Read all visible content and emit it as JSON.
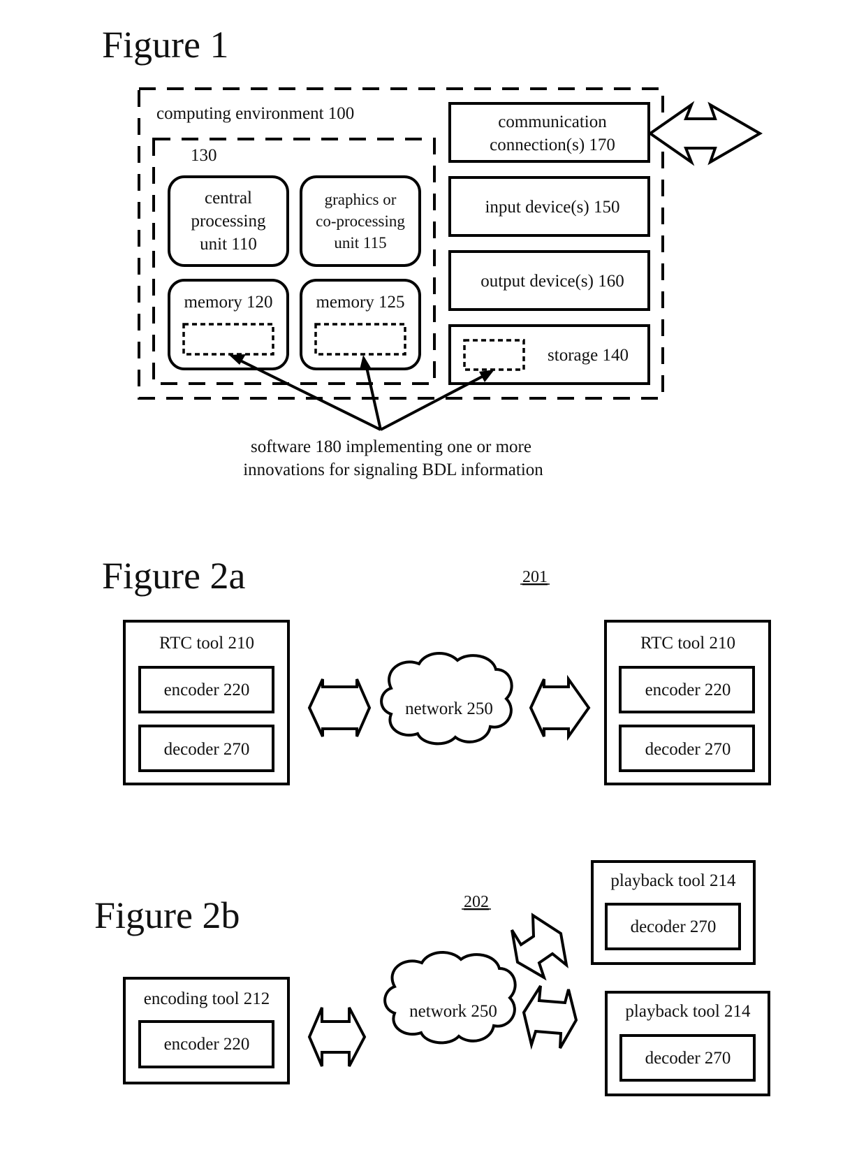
{
  "figure1": {
    "title": "Figure 1",
    "computing_environment": "computing environment 100",
    "group_label": "130",
    "cpu": [
      "central",
      "processing",
      "unit 110"
    ],
    "gpu": [
      "graphics or",
      "co-processing",
      "unit 115"
    ],
    "memory_120": "memory 120",
    "memory_125": "memory 125",
    "communication": [
      "communication",
      "connection(s) 170"
    ],
    "input": "input device(s) 150",
    "output": "output device(s) 160",
    "storage": "storage 140",
    "software": [
      "software 180 implementing one or more",
      "innovations for signaling BDL information"
    ]
  },
  "figure2a": {
    "title": "Figure 2a",
    "ref": "201",
    "left_tool": {
      "title": "RTC tool 210",
      "encoder": "encoder 220",
      "decoder": "decoder 270"
    },
    "network": "network 250",
    "right_tool": {
      "title": "RTC tool 210",
      "encoder": "encoder 220",
      "decoder": "decoder 270"
    }
  },
  "figure2b": {
    "title": "Figure 2b",
    "ref": "202",
    "encoding_tool": {
      "title": "encoding tool 212",
      "encoder": "encoder 220"
    },
    "network": "network 250",
    "playback_top": {
      "title": "playback tool 214",
      "decoder": "decoder 270"
    },
    "playback_bottom": {
      "title": "playback tool 214",
      "decoder": "decoder 270"
    }
  }
}
